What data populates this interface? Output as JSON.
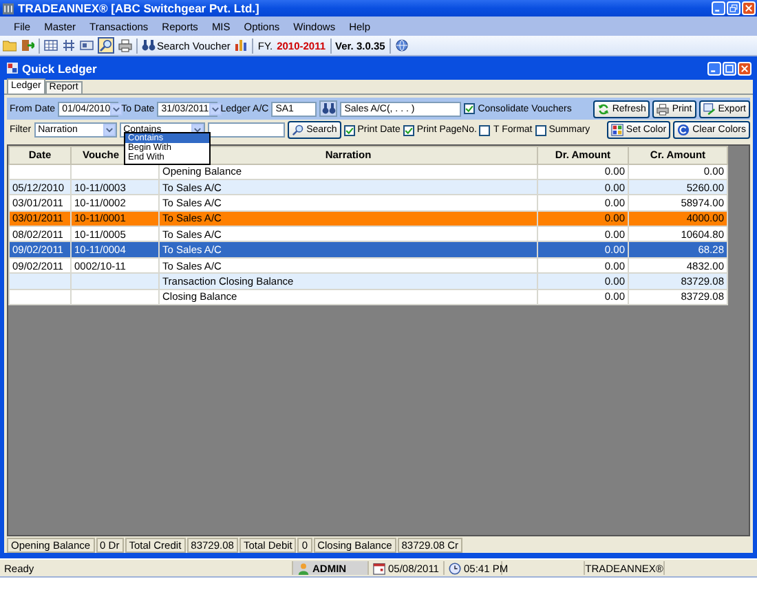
{
  "app": {
    "title": "TRADEANNEX® [ABC Switchgear Pvt. Ltd.]"
  },
  "menu": [
    "File",
    "Master",
    "Transactions",
    "Reports",
    "MIS",
    "Options",
    "Windows",
    "Help"
  ],
  "toolbar": {
    "search_button": "Search Voucher",
    "fy_label": "FY.",
    "fy_value": "2010-2011",
    "version": "Ver. 3.0.35"
  },
  "window": {
    "title": "Quick Ledger"
  },
  "tabs": [
    {
      "label": "Ledger",
      "selected": true
    },
    {
      "label": "Report",
      "selected": false
    }
  ],
  "criteria": {
    "from_label": "From Date",
    "from_value": "01/04/2010",
    "to_label": "To Date",
    "to_value": "31/03/2011",
    "ledger_label": "Ledger A/C",
    "ledger_code": "SA1",
    "ledger_name": "Sales A/C(, . . . )",
    "consolidate": {
      "label": "Consolidate Vouchers",
      "checked": true
    },
    "buttons": [
      "Refresh",
      "Print",
      "Export"
    ]
  },
  "filter": {
    "label": "Filter",
    "field": "Narration",
    "mode": "Contains",
    "search_button": "Search",
    "options": [
      {
        "label": "Print Date",
        "checked": true
      },
      {
        "label": "Print PageNo.",
        "checked": true
      },
      {
        "label": "T Format",
        "checked": false
      },
      {
        "label": "Summary",
        "checked": false
      }
    ],
    "buttons": [
      "Set Color",
      "Clear Colors"
    ]
  },
  "filter_dropdown": [
    {
      "label": "Contains",
      "selected": true
    },
    {
      "label": "Begin With",
      "selected": false
    },
    {
      "label": "End With",
      "selected": false
    }
  ],
  "grid": {
    "columns": [
      "Date",
      "Vouche",
      "Narration",
      "Dr. Amount",
      "Cr. Amount"
    ],
    "rows": [
      {
        "cells": [
          "",
          "",
          "Opening Balance",
          "0.00",
          "0.00"
        ],
        "selected": false
      },
      {
        "cells": [
          "05/12/2010",
          "10-11/0003",
          "To Sales A/C",
          "0.00",
          "5260.00"
        ],
        "selected": false
      },
      {
        "cells": [
          "03/01/2011",
          "10-11/0002",
          "To Sales A/C",
          "0.00",
          "58974.00"
        ],
        "selected": false
      },
      {
        "cells": [
          "03/01/2011",
          "10-11/0001",
          "To Sales A/C",
          "0.00",
          "4000.00"
        ],
        "selected": false,
        "color": "#ff8000"
      },
      {
        "cells": [
          "08/02/2011",
          "10-11/0005",
          "To Sales A/C",
          "0.00",
          "10604.80"
        ],
        "selected": false
      },
      {
        "cells": [
          "09/02/2011",
          "10-11/0004",
          "To Sales A/C",
          "0.00",
          "68.28"
        ],
        "selected": true
      },
      {
        "cells": [
          "09/02/2011",
          "0002/10-11",
          "To Sales A/C",
          "0.00",
          "4832.00"
        ],
        "selected": false
      },
      {
        "cells": [
          "",
          "",
          "Transaction Closing Balance",
          "0.00",
          "83729.08"
        ],
        "selected": false
      },
      {
        "cells": [
          "",
          "",
          "Closing Balance",
          "0.00",
          "83729.08"
        ],
        "selected": false
      }
    ]
  },
  "totals": [
    "Opening Balance",
    "0 Dr",
    "Total Credit",
    "83729.08",
    "Total Debit",
    "0",
    "Closing Balance",
    "83729.08 Cr"
  ],
  "status_bar": {
    "message": "Ready",
    "user": "ADMIN",
    "date": "05/08/2011",
    "time": "05:41 PM",
    "product": "TRADEANNEX®"
  }
}
